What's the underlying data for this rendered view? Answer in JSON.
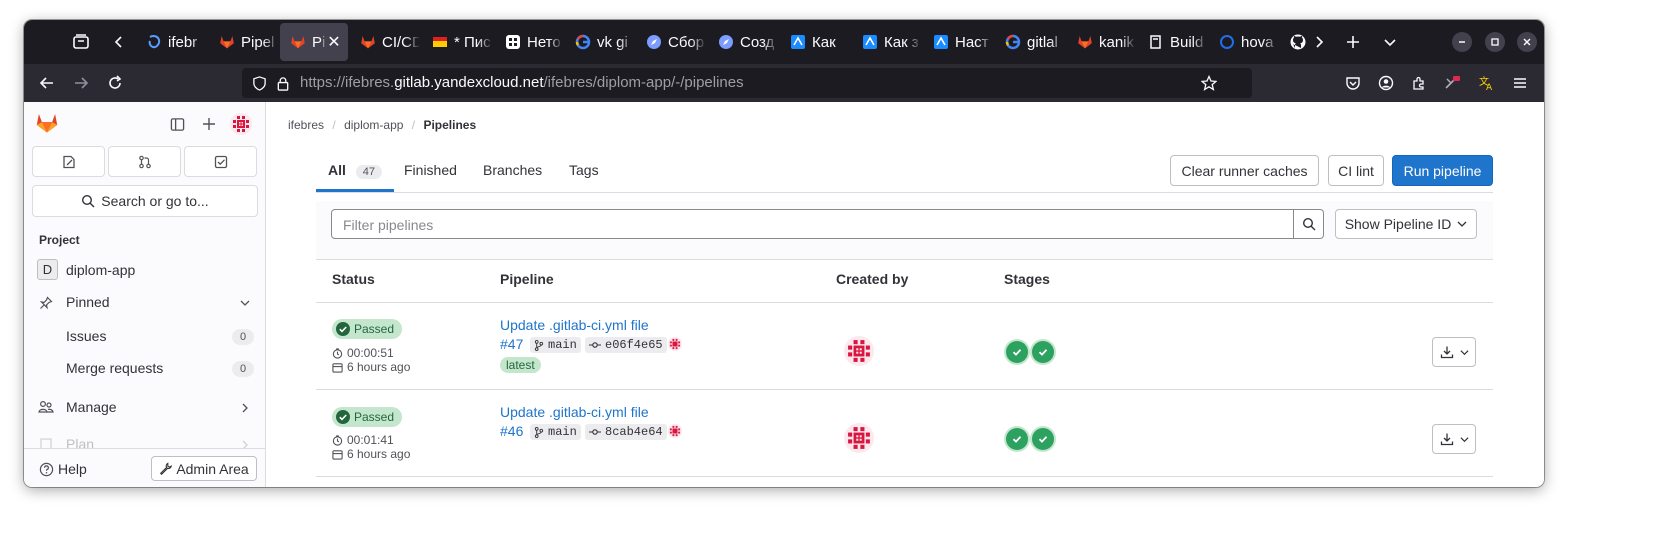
{
  "browser": {
    "tabs": [
      {
        "label": "ifebr",
        "icon": "firefox-view-icon"
      },
      {
        "label": "Pipel",
        "icon": "gitlab-favicon-icon"
      },
      {
        "label": "Pip",
        "icon": "gitlab-favicon-icon",
        "active": true
      },
      {
        "label": "CI/CD",
        "icon": "gitlab-favicon-icon"
      },
      {
        "label": "* Пис",
        "icon": "mail-favicon-icon"
      },
      {
        "label": "Нето",
        "icon": "netology-favicon-icon"
      },
      {
        "label": "vk gi",
        "icon": "google-favicon-icon"
      },
      {
        "label": "Сбор",
        "icon": "compass-favicon-icon"
      },
      {
        "label": "Созд",
        "icon": "compass-favicon-icon"
      },
      {
        "label": "Как",
        "icon": "yandex-cloud-favicon-icon"
      },
      {
        "label": "Как з",
        "icon": "yandex-cloud-favicon-icon"
      },
      {
        "label": "Наст",
        "icon": "yandex-cloud-favicon-icon"
      },
      {
        "label": "gitlal",
        "icon": "google-favicon-icon"
      },
      {
        "label": "kanik",
        "icon": "gitlab-favicon-icon"
      },
      {
        "label": "Build",
        "icon": "book-favicon-icon"
      },
      {
        "label": "hova",
        "icon": "circle-favicon-icon"
      },
      {
        "label": "",
        "icon": "github-favicon-icon"
      }
    ],
    "url_prefix": "https://ifebres.",
    "url_host": "gitlab.yandexcloud.net",
    "url_path": "/ifebres/diplom-app/-/pipelines"
  },
  "sidebar": {
    "search_label": "Search or go to...",
    "section_title": "Project",
    "project_initial": "D",
    "project_name": "diplom-app",
    "pinned_label": "Pinned",
    "issues_label": "Issues",
    "issues_count": "0",
    "merge_requests_label": "Merge requests",
    "merge_requests_count": "0",
    "manage_label": "Manage",
    "plan_label": "Plan",
    "help_label": "Help",
    "admin_label": "Admin Area"
  },
  "breadcrumb": {
    "items": [
      "ifebres",
      "diplom-app",
      "Pipelines"
    ]
  },
  "tabs": [
    {
      "label": "All",
      "count": "47"
    },
    {
      "label": "Finished"
    },
    {
      "label": "Branches"
    },
    {
      "label": "Tags"
    }
  ],
  "actions": {
    "clear_caches": "Clear runner caches",
    "ci_lint": "CI lint",
    "run_pipeline": "Run pipeline"
  },
  "filter": {
    "placeholder": "Filter pipelines",
    "show_id_label": "Show Pipeline ID"
  },
  "table": {
    "headers": [
      "Status",
      "Pipeline",
      "Created by",
      "Stages"
    ],
    "rows": [
      {
        "status": "Passed",
        "duration": "00:00:51",
        "finished": "6 hours ago",
        "title": "Update .gitlab-ci.yml file",
        "id": "#47",
        "branch": "main",
        "commit": "e06f4e65",
        "tag": "latest",
        "stages": [
          "passed",
          "passed"
        ]
      },
      {
        "status": "Passed",
        "duration": "00:01:41",
        "finished": "6 hours ago",
        "title": "Update .gitlab-ci.yml file",
        "id": "#46",
        "branch": "main",
        "commit": "8cab4e64",
        "tag": "",
        "stages": [
          "passed",
          "passed"
        ]
      }
    ]
  },
  "colors": {
    "gitlab_orange": "#e24329",
    "link_blue": "#1f75cb",
    "success_green": "#2da160",
    "avatar_pink": "#d9163f"
  }
}
